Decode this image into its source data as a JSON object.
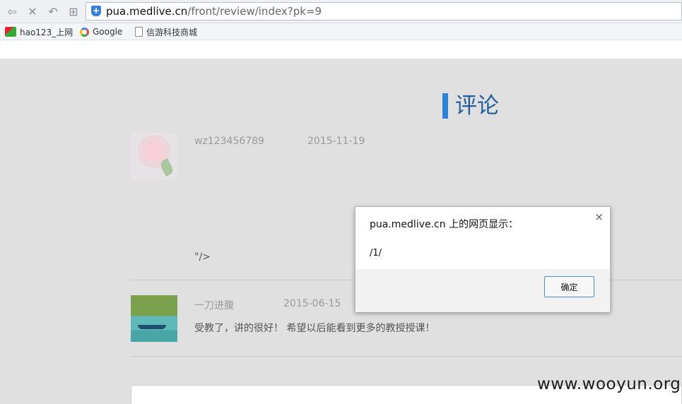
{
  "browser": {
    "url_host": "pua.medlive.cn",
    "url_path": "/front/review/index?pk=9",
    "bookmarks": [
      {
        "label": "hao123_上网",
        "icon": "hao123-icon"
      },
      {
        "label": "Google",
        "icon": "google-icon"
      },
      {
        "label": "信游科技商城",
        "icon": "page-icon"
      }
    ]
  },
  "page": {
    "title": "评论",
    "comments": [
      {
        "user": "wz123456789",
        "date": "2015-11-19",
        "text": "\"/>"
      },
      {
        "user": "一刀进腹",
        "date": "2015-06-15",
        "text": "受教了，讲的很好！ 希望以后能看到更多的教授授课！"
      }
    ],
    "watermark": "www.wooyun.org"
  },
  "dialog": {
    "title": "pua.medlive.cn 上的网页显示：",
    "message": "/1/",
    "ok_label": "确定",
    "close_glyph": "×"
  }
}
